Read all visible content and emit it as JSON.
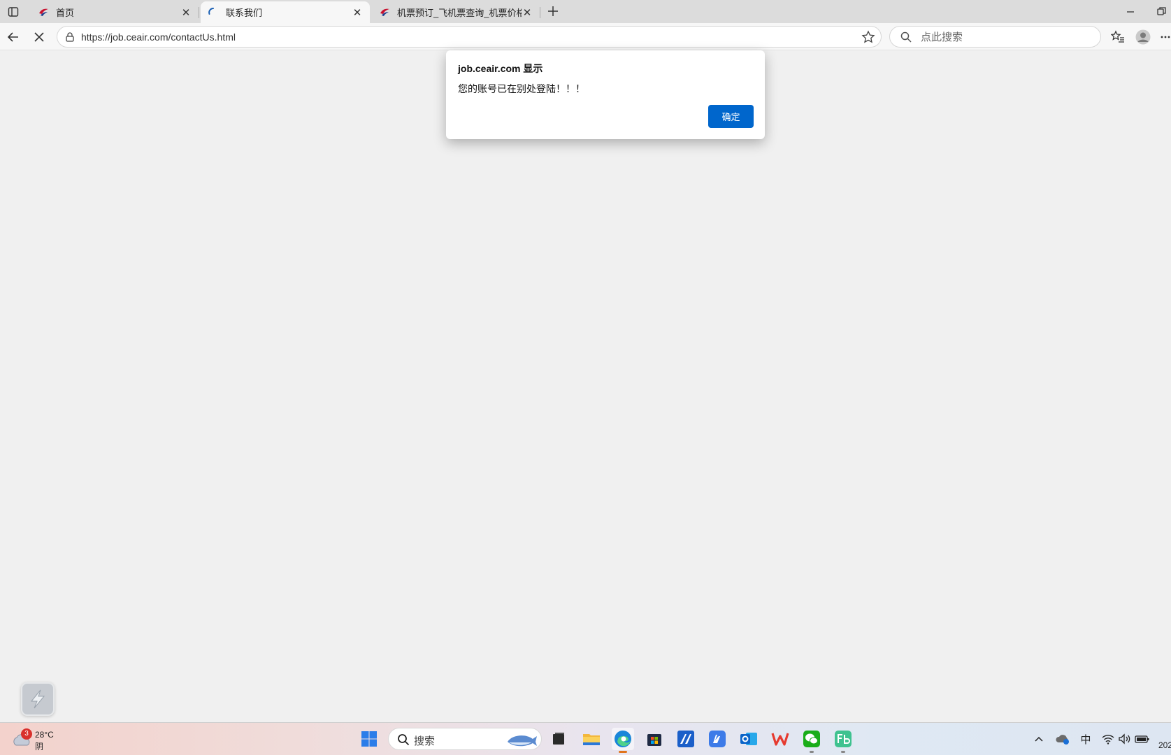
{
  "tabs": [
    {
      "title": "首页",
      "favicon": "china-eastern-logo-icon",
      "active": false
    },
    {
      "title": "联系我们",
      "favicon": "loading-spinner-icon",
      "active": true
    },
    {
      "title": "机票预订_飞机票查询_机票价格查",
      "favicon": "china-eastern-logo-icon",
      "active": false
    }
  ],
  "address_bar": {
    "url": "https://job.ceair.com/contactUs.html"
  },
  "search_box": {
    "placeholder": "点此搜索"
  },
  "dialog": {
    "title": "job.ceair.com 显示",
    "message": "您的账号已在别处登陆！！！",
    "ok_label": "确定"
  },
  "colors": {
    "accent": "#0066cc",
    "badge": "#d9302c"
  },
  "taskbar": {
    "weather": {
      "badge": "3",
      "temp": "28°C",
      "condition": "阴"
    },
    "search_label": "搜索",
    "ime_label": "中",
    "clock_fragment": "202",
    "apps": [
      "start-icon",
      "search",
      "task-view-icon",
      "file-explorer-icon",
      "edge-icon",
      "store-icon",
      "app-icon",
      "app-icon",
      "outlook-icon",
      "wps-icon",
      "wechat-icon",
      "feishu-icon"
    ]
  }
}
